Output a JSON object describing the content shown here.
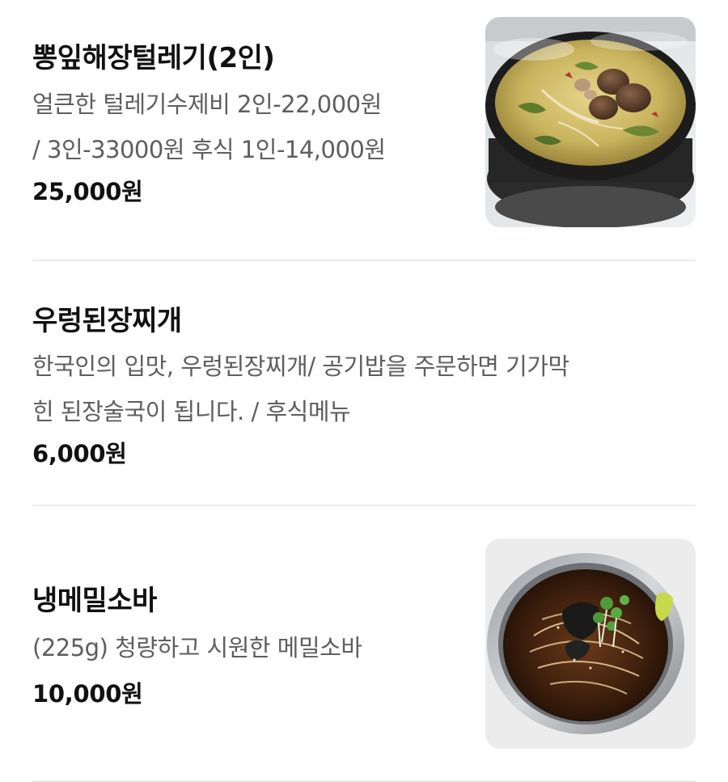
{
  "menu": {
    "items": [
      {
        "name": "뽕잎해장털레기(2인)",
        "description": [
          "얼큰한 털레기수제비 2인-22,000원",
          "/ 3인-33000원 후식 1인-14,000원"
        ],
        "price": "25,000원",
        "image": "stew-hot-pot-photo"
      },
      {
        "name": "우렁된장찌개",
        "description": [
          "한국인의 입맛, 우렁된장찌개/ 공기밥을 주문하면 기가막",
          "힌 된장술국이 됩니다. / 후식메뉴"
        ],
        "price": "6,000원",
        "image": null
      },
      {
        "name": "냉메밀소바",
        "description": [
          "(225g) 청량하고 시원한 메밀소바"
        ],
        "price": "10,000원",
        "image": "cold-buckwheat-noodle-photo"
      }
    ]
  },
  "colors": {
    "text_primary": "#111111",
    "text_secondary": "#5e5e5e",
    "divider": "#ececec",
    "background": "#ffffff"
  }
}
